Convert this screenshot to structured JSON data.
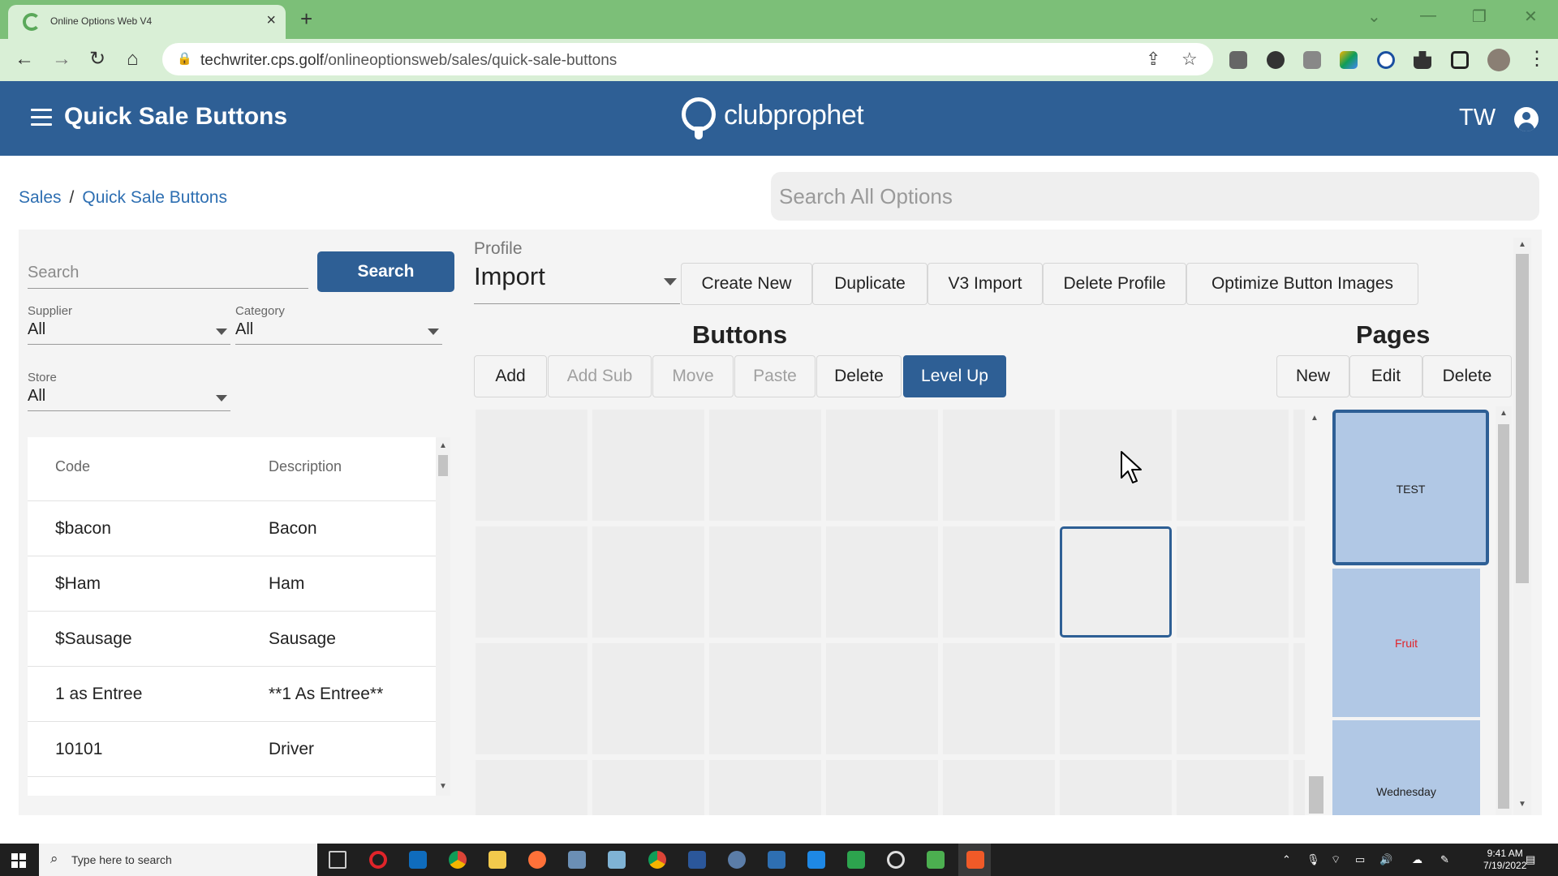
{
  "browser": {
    "tab_title": "Online Options Web V4",
    "url_host": "techwriter.cps.golf",
    "url_path": "/onlineoptionsweb/sales/quick-sale-buttons"
  },
  "header": {
    "title": "Quick Sale Buttons",
    "logo_text": "clubprophet",
    "user_initials": "TW"
  },
  "breadcrumb": {
    "root": "Sales",
    "current": "Quick Sale Buttons"
  },
  "global_search": {
    "placeholder": "Search All Options"
  },
  "item_panel": {
    "search_placeholder": "Search",
    "search_button": "Search",
    "supplier_label": "Supplier",
    "supplier_value": "All",
    "category_label": "Category",
    "category_value": "All",
    "store_label": "Store",
    "store_value": "All",
    "columns": [
      "Code",
      "Description"
    ],
    "rows": [
      {
        "code": "$bacon",
        "description": "Bacon"
      },
      {
        "code": "$Ham",
        "description": "Ham"
      },
      {
        "code": "$Sausage",
        "description": "Sausage"
      },
      {
        "code": "1 as Entree",
        "description": "**1 As Entree**"
      },
      {
        "code": "10101",
        "description": "Driver"
      }
    ]
  },
  "profile": {
    "label": "Profile",
    "value": "Import",
    "actions": [
      "Create New",
      "Duplicate",
      "V3 Import",
      "Delete Profile",
      "Optimize Button Images"
    ]
  },
  "buttons_section": {
    "title": "Buttons",
    "actions": [
      "Add",
      "Add Sub",
      "Move",
      "Paste",
      "Delete",
      "Level Up"
    ]
  },
  "pages_section": {
    "title": "Pages",
    "actions": [
      "New",
      "Edit",
      "Delete"
    ],
    "pages": [
      "TEST",
      "Fruit",
      "Wednesday"
    ],
    "colors": {
      "Fruit": "#e0242a"
    }
  },
  "taskbar": {
    "search_placeholder": "Type here to search",
    "time": "9:41 AM",
    "date": "7/19/2022"
  },
  "colors": {
    "brand_blue": "#2e5f95",
    "chrome_green": "#7cbf78",
    "link_blue": "#2e6fb2"
  }
}
